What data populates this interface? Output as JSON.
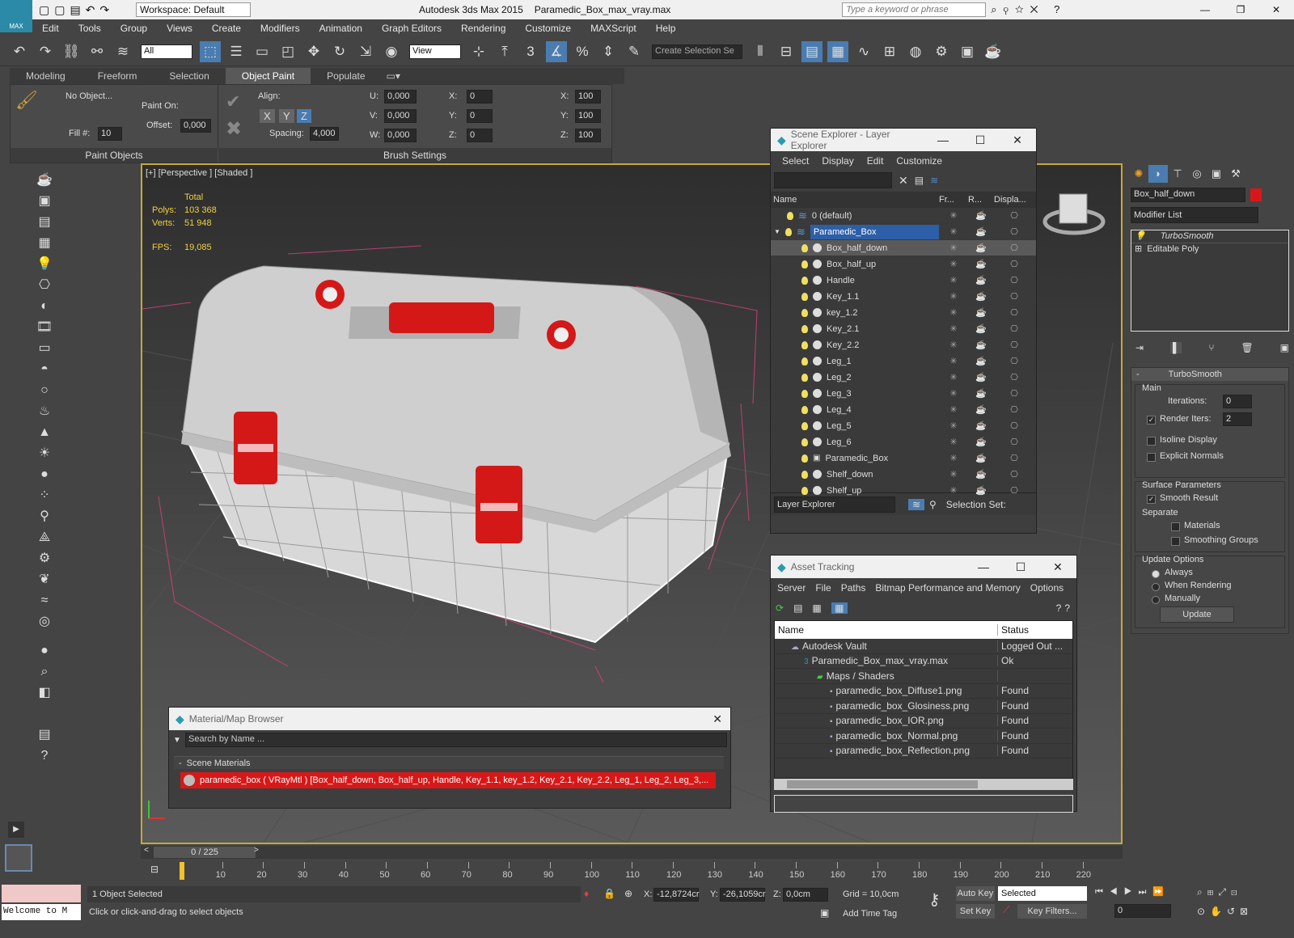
{
  "app": {
    "logo_text": "MAX",
    "workspace": "Workspace: Default",
    "title": "Autodesk 3ds Max  2015",
    "filename": "Paramedic_Box_max_vray.max",
    "search_placeholder": "Type a keyword or phrase"
  },
  "menu": [
    "Edit",
    "Tools",
    "Group",
    "Views",
    "Create",
    "Modifiers",
    "Animation",
    "Graph Editors",
    "Rendering",
    "Customize",
    "MAXScript",
    "Help"
  ],
  "toolbar": {
    "filter_value": "All",
    "refcoord_value": "View",
    "selset_placeholder": "Create Selection Se",
    "snap_number": "3"
  },
  "ribbon": {
    "tabs": [
      "Modeling",
      "Freeform",
      "Selection",
      "Object Paint",
      "Populate"
    ],
    "active_tab": "Object Paint",
    "no_object": "No Object...",
    "fill_label": "Fill #:",
    "fill_value": "10",
    "paint_on": "Paint On:",
    "offset": "Offset:",
    "offset_value": "0,000",
    "align": "Align:",
    "axes": [
      "X",
      "Y",
      "Z"
    ],
    "spacing": "Spacing:",
    "spacing_value": "4,000",
    "u": "U:",
    "v": "V:",
    "w": "W:",
    "uvw_value": "0,000",
    "x": "X:",
    "y": "Y:",
    "z": "Z:",
    "xyz_value": "0",
    "sx": "X:",
    "sy": "Y:",
    "sz": "Z:",
    "scale_value": "100",
    "paint_objects": "Paint Objects",
    "brush_settings": "Brush Settings"
  },
  "viewport": {
    "label": "[+] [Perspective ] [Shaded ]",
    "stats_total": "Total",
    "polys_label": "Polys:",
    "polys": "103 368",
    "verts_label": "Verts:",
    "verts": "51 948",
    "fps_label": "FPS:",
    "fps": "19,085"
  },
  "scene_explorer": {
    "title": "Scene Explorer - Layer Explorer",
    "menu": [
      "Select",
      "Display",
      "Edit",
      "Customize"
    ],
    "columns": [
      "Name",
      "Fr...",
      "R...",
      "Displa..."
    ],
    "rows": [
      {
        "name": "0 (default)",
        "level": 0,
        "type": "layer"
      },
      {
        "name": "Paramedic_Box",
        "level": 0,
        "type": "layer",
        "selected": true
      },
      {
        "name": "Box_half_down",
        "level": 1,
        "type": "obj",
        "hl": true
      },
      {
        "name": "Box_half_up",
        "level": 1,
        "type": "obj"
      },
      {
        "name": "Handle",
        "level": 1,
        "type": "obj"
      },
      {
        "name": "Key_1.1",
        "level": 1,
        "type": "obj"
      },
      {
        "name": "key_1.2",
        "level": 1,
        "type": "obj"
      },
      {
        "name": "Key_2.1",
        "level": 1,
        "type": "obj"
      },
      {
        "name": "Key_2.2",
        "level": 1,
        "type": "obj"
      },
      {
        "name": "Leg_1",
        "level": 1,
        "type": "obj"
      },
      {
        "name": "Leg_2",
        "level": 1,
        "type": "obj"
      },
      {
        "name": "Leg_3",
        "level": 1,
        "type": "obj"
      },
      {
        "name": "Leg_4",
        "level": 1,
        "type": "obj"
      },
      {
        "name": "Leg_5",
        "level": 1,
        "type": "obj"
      },
      {
        "name": "Leg_6",
        "level": 1,
        "type": "obj"
      },
      {
        "name": "Paramedic_Box",
        "level": 1,
        "type": "group"
      },
      {
        "name": "Shelf_down",
        "level": 1,
        "type": "obj"
      },
      {
        "name": "Shelf_up",
        "level": 1,
        "type": "obj"
      }
    ],
    "footer_mode": "Layer Explorer",
    "selection_set": "Selection Set:"
  },
  "asset_tracking": {
    "title": "Asset Tracking",
    "menu": [
      "Server",
      "File",
      "Paths",
      "Bitmap Performance and Memory",
      "Options"
    ],
    "columns": [
      "Name",
      "Status"
    ],
    "rows": [
      {
        "name": "Autodesk Vault",
        "status": "Logged Out ...",
        "indent": 1
      },
      {
        "name": "Paramedic_Box_max_vray.max",
        "status": "Ok",
        "indent": 2
      },
      {
        "name": "Maps / Shaders",
        "status": "",
        "indent": 3
      },
      {
        "name": "paramedic_box_Diffuse1.png",
        "status": "Found",
        "indent": 4
      },
      {
        "name": "paramedic_box_Glosiness.png",
        "status": "Found",
        "indent": 4
      },
      {
        "name": "paramedic_box_IOR.png",
        "status": "Found",
        "indent": 4
      },
      {
        "name": "paramedic_box_Normal.png",
        "status": "Found",
        "indent": 4
      },
      {
        "name": "paramedic_box_Reflection.png",
        "status": "Found",
        "indent": 4
      }
    ]
  },
  "material_browser": {
    "title": "Material/Map Browser",
    "search": "Search by Name ...",
    "section": "Scene Materials",
    "item": "paramedic_box  ( VRayMtl )  [Box_half_down, Box_half_up, Handle, Key_1.1, key_1.2, Key_2.1, Key_2.2, Leg_1, Leg_2, Leg_3,..."
  },
  "command_panel": {
    "object_name": "Box_half_down",
    "modifier_list": "Modifier List",
    "stack": [
      "TurboSmooth",
      "Editable Poly"
    ],
    "rollout": "TurboSmooth",
    "main": "Main",
    "iterations_label": "Iterations:",
    "iterations": "0",
    "render_iters_label": "Render Iters:",
    "render_iters": "2",
    "isoline": "Isoline Display",
    "explicit": "Explicit Normals",
    "surface": "Surface Parameters",
    "smooth_result": "Smooth Result",
    "separate": "Separate",
    "materials": "Materials",
    "smoothing_groups": "Smoothing Groups",
    "update_options": "Update Options",
    "always": "Always",
    "when_rendering": "When Rendering",
    "manually": "Manually",
    "update": "Update"
  },
  "timeline": {
    "frame": "0 / 225",
    "ticks": [
      "10",
      "20",
      "30",
      "40",
      "50",
      "60",
      "70",
      "80",
      "90",
      "100",
      "110",
      "120",
      "130",
      "140",
      "150",
      "160",
      "170",
      "180",
      "190",
      "200",
      "210",
      "220"
    ]
  },
  "status": {
    "maxscript": "Welcome to M",
    "selected": "1 Object Selected",
    "prompt": "Click or click-and-drag to select objects",
    "x_label": "X:",
    "x": "-12,8724cr",
    "y_label": "Y:",
    "y": "-26,1059cr",
    "z_label": "Z:",
    "z": "0,0cm",
    "grid": "Grid = 10,0cm",
    "add_time_tag": "Add Time Tag",
    "auto_key": "Auto Key",
    "set_key": "Set Key",
    "key_mode": "Selected",
    "key_filters": "Key Filters...",
    "frame_value": "0"
  }
}
